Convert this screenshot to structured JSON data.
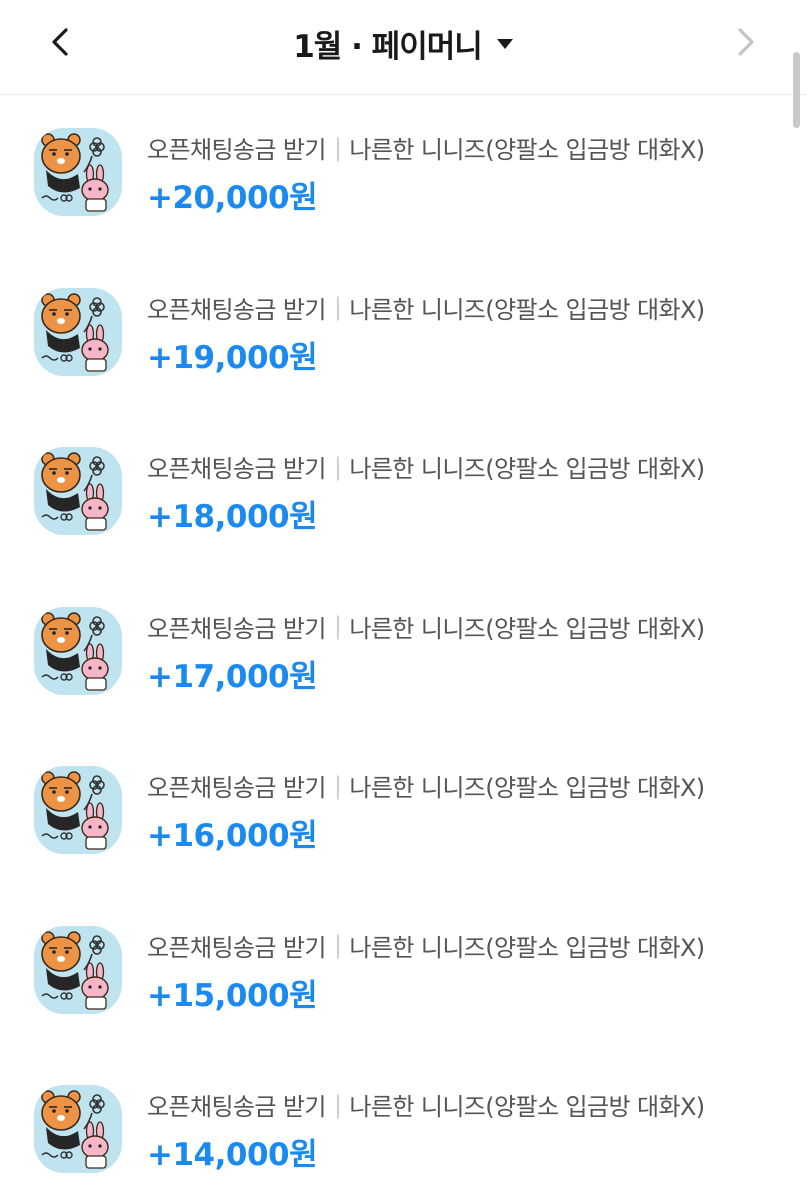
{
  "header": {
    "title": "1월 · 페이머니",
    "back_icon": "chevron-left-icon",
    "forward_icon": "chevron-right-icon",
    "dropdown_icon": "caret-down-icon"
  },
  "colors": {
    "amount": "#1a8af0",
    "avatar_bg": "#bfe3ef",
    "forward_disabled": "#c4c4c4"
  },
  "transactions": [
    {
      "category": "오픈채팅송금 받기",
      "memo": "나른한 니니즈(양팔소 입금방 대화X)",
      "amount": "+20,000원"
    },
    {
      "category": "오픈채팅송금 받기",
      "memo": "나른한 니니즈(양팔소 입금방 대화X)",
      "amount": "+19,000원"
    },
    {
      "category": "오픈채팅송금 받기",
      "memo": "나른한 니니즈(양팔소 입금방 대화X)",
      "amount": "+18,000원"
    },
    {
      "category": "오픈채팅송금 받기",
      "memo": "나른한 니니즈(양팔소 입금방 대화X)",
      "amount": "+17,000원"
    },
    {
      "category": "오픈채팅송금 받기",
      "memo": "나른한 니니즈(양팔소 입금방 대화X)",
      "amount": "+16,000원"
    },
    {
      "category": "오픈채팅송금 받기",
      "memo": "나른한 니니즈(양팔소 입금방 대화X)",
      "amount": "+15,000원"
    },
    {
      "category": "오픈채팅송금 받기",
      "memo": "나른한 니니즈(양팔소 입금방 대화X)",
      "amount": "+14,000원"
    }
  ]
}
